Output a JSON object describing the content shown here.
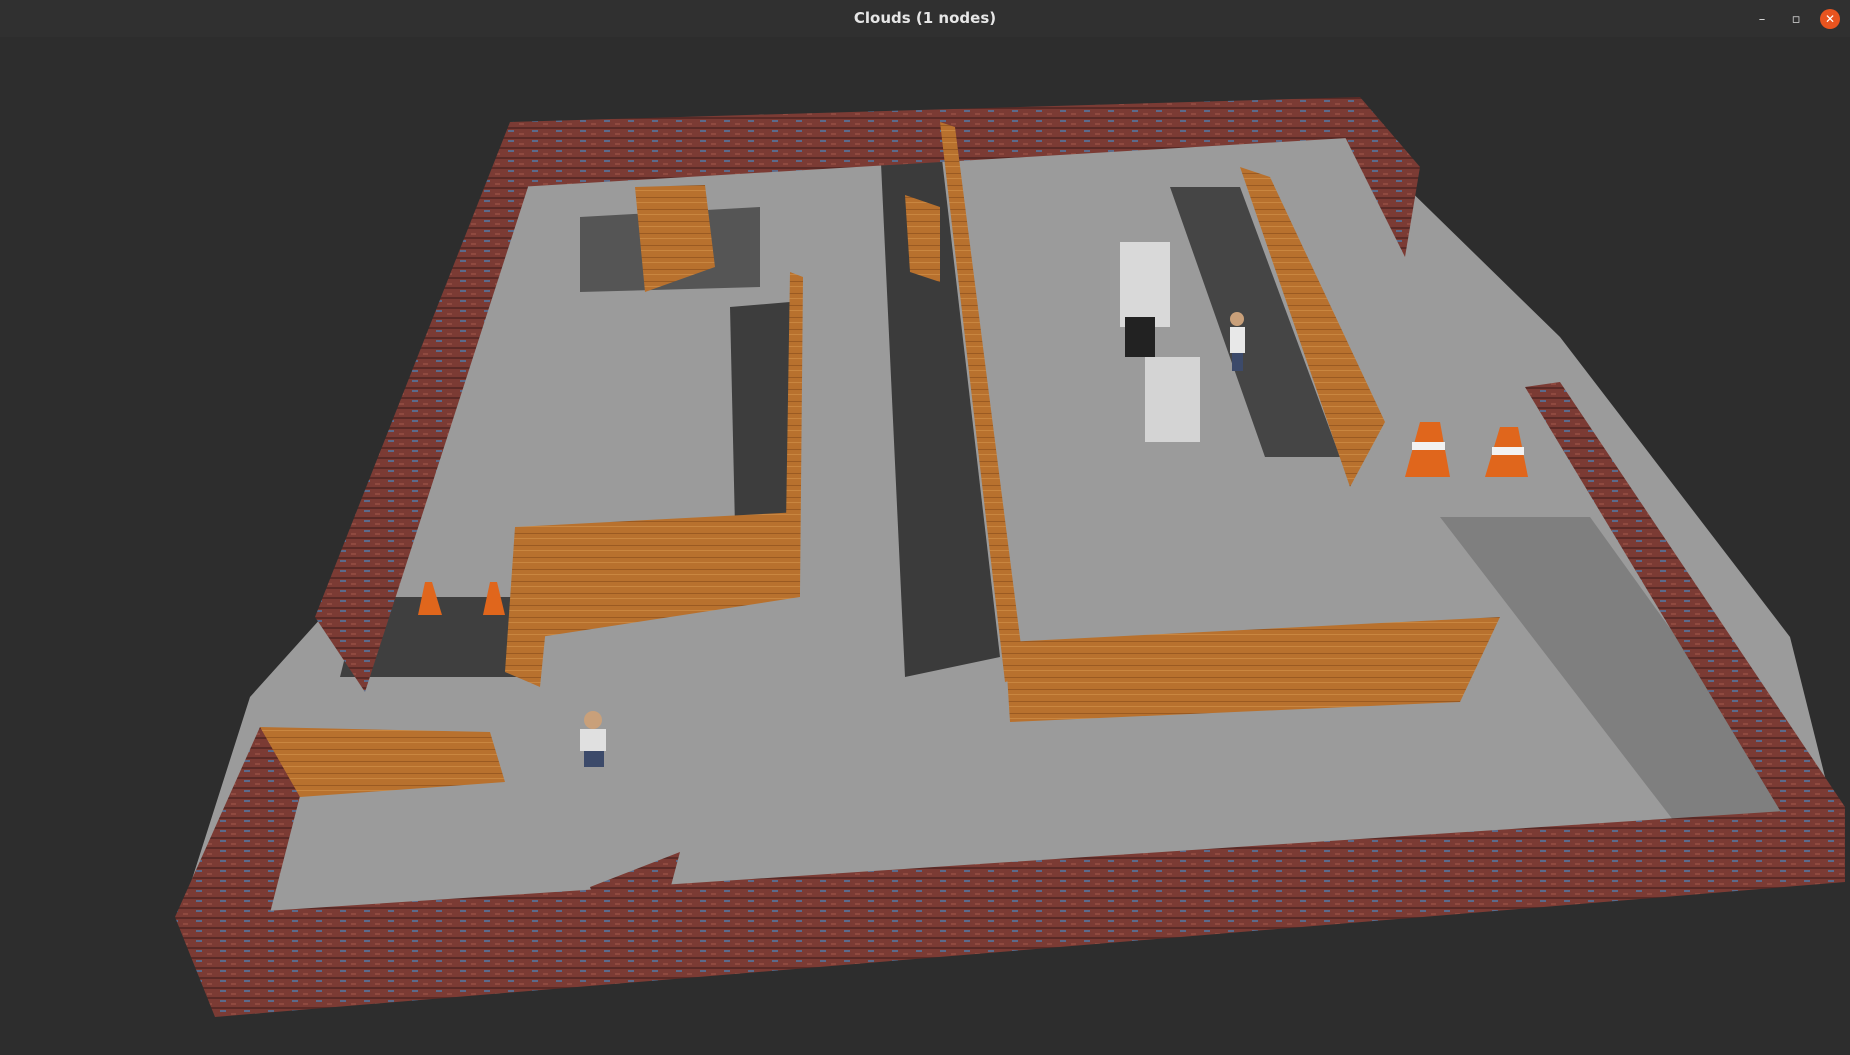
{
  "window": {
    "title": "Clouds (1 nodes)",
    "controls": {
      "minimize_icon": "minimize-icon",
      "restore_icon": "restore-icon",
      "close_icon": "close-icon"
    }
  },
  "colors": {
    "background": "#2d2d2d",
    "floor": "#9a9a9a",
    "shadow": "#3a3a3a",
    "brick": "#7a3a33",
    "wood": "#b8712e",
    "close_button": "#e9541f"
  },
  "scene": {
    "type": "3d-point-cloud-view",
    "objects": [
      "brick-perimeter-wall",
      "wooden-partition-wall",
      "traffic-cone",
      "person",
      "cabinet",
      "crate"
    ]
  }
}
